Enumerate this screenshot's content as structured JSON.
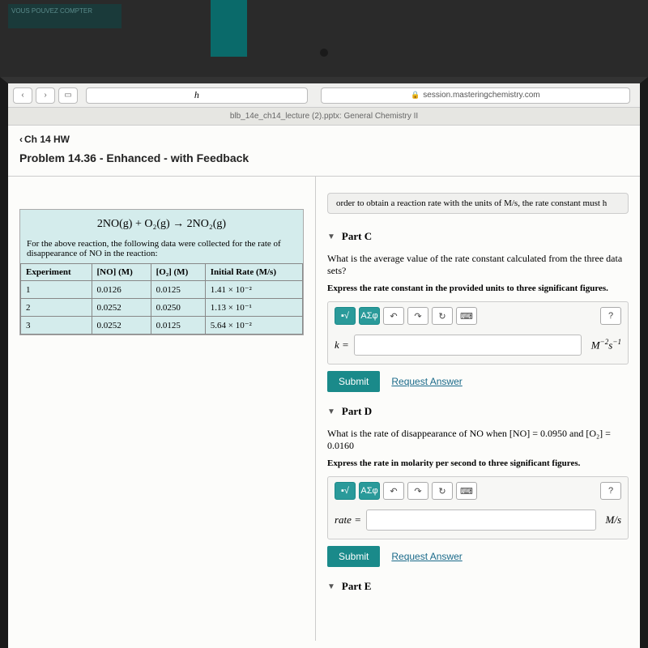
{
  "poster_text": "VOUS POUVEZ COMPTER",
  "browser": {
    "script_char": "h",
    "url_domain": "session.masteringchemistry.com",
    "tab_title": "blb_14e_ch14_lecture (2).pptx: General Chemistry II"
  },
  "breadcrumb": "Ch 14 HW",
  "page_title": "Problem 14.36 - Enhanced - with Feedback",
  "hint_text": "order to obtain a reaction rate with the units of M/s, the rate constant must h",
  "equation": "2NO(g) + O₂(g) → 2NO₂(g)",
  "data_desc": "For the above reaction, the following data were collected for the rate of disappearance of NO in the reaction:",
  "table": {
    "headers": [
      "Experiment",
      "[NO] (M)",
      "[O₂] (M)",
      "Initial Rate (M/s)"
    ],
    "rows": [
      [
        "1",
        "0.0126",
        "0.0125",
        "1.41 × 10⁻²"
      ],
      [
        "2",
        "0.0252",
        "0.0250",
        "1.13 × 10⁻¹"
      ],
      [
        "3",
        "0.0252",
        "0.0125",
        "5.64 × 10⁻²"
      ]
    ]
  },
  "partC": {
    "title": "Part C",
    "question": "What is the average value of the rate constant calculated from the three data sets?",
    "instruction": "Express the rate constant in the provided units to three significant figures.",
    "var": "k =",
    "unit": "M⁻²s⁻¹",
    "submit": "Submit",
    "request": "Request Answer"
  },
  "partD": {
    "title": "Part D",
    "question": "What is the rate of disappearance of NO when [NO] = 0.0950 and [O₂] = 0.0160",
    "instruction": "Express the rate in molarity per second to three significant figures.",
    "var": "rate =",
    "unit": "M/s",
    "submit": "Submit",
    "request": "Request Answer"
  },
  "partE": {
    "title": "Part E"
  },
  "symbols": {
    "greek": "ΑΣφ",
    "undo": "↶",
    "redo": "↷",
    "reset": "↻",
    "keyb": "⌨",
    "help": "?"
  }
}
